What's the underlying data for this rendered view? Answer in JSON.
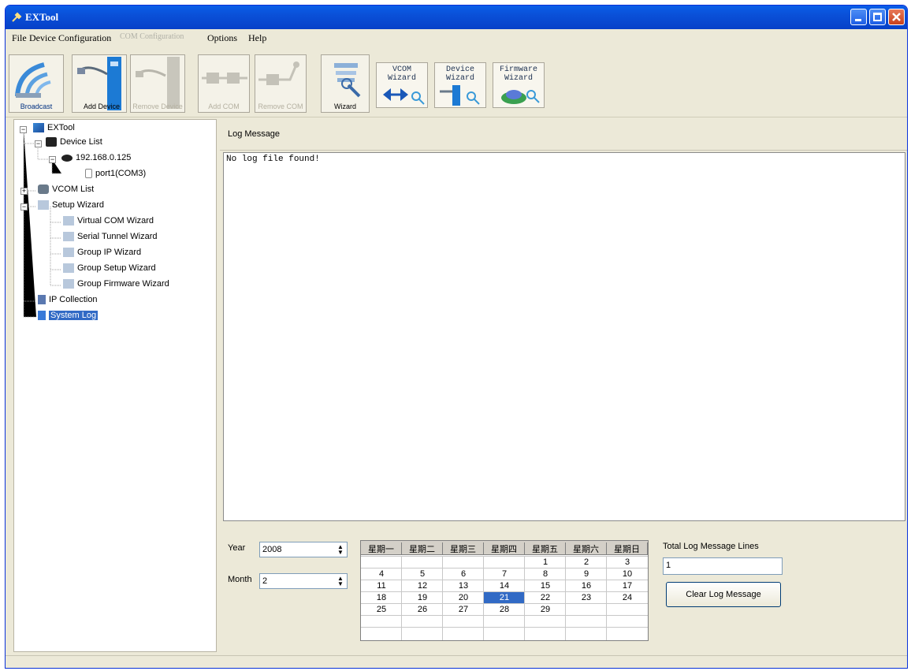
{
  "window": {
    "title": "EXTool"
  },
  "menu": {
    "file": "File",
    "device_config": "Device Configuration",
    "com_config": "COM Configuration",
    "options": "Options",
    "help": "Help"
  },
  "toolbar": {
    "broadcast": "Broadcast",
    "add_device": "Add Device",
    "remove_device": "Remove Device",
    "add_com": "Add COM",
    "remove_com": "Remove COM",
    "wizard": "Wizard",
    "vcom_wizard": "VCOM\nWizard",
    "device_wizard": "Device\nWizard",
    "firmware_wizard": "Firmware\nWizard"
  },
  "tree": {
    "root": "EXTool",
    "device_list": "Device List",
    "ip": "192.168.0.125",
    "port": "port1(COM3)",
    "vcom_list": "VCOM List",
    "setup_wizard": "Setup Wizard",
    "wizards": [
      "Virtual COM Wizard",
      "Serial Tunnel Wizard",
      "Group IP Wizard",
      "Group Setup Wizard",
      "Group Firmware Wizard"
    ],
    "ip_collection": "IP Collection",
    "system_log": "System Log"
  },
  "log": {
    "header": "Log Message",
    "content": "No log file found!"
  },
  "controls": {
    "year_label": "Year",
    "year_value": "2008",
    "month_label": "Month",
    "month_value": "2",
    "total_label": "Total Log Message Lines",
    "total_value": "1",
    "clear_button": "Clear Log Message"
  },
  "calendar": {
    "weekdays": [
      "星期一",
      "星期二",
      "星期三",
      "星期四",
      "星期五",
      "星期六",
      "星期日"
    ],
    "weeks": [
      [
        "",
        "",
        "",
        "",
        "1",
        "2",
        "3"
      ],
      [
        "4",
        "5",
        "6",
        "7",
        "8",
        "9",
        "10"
      ],
      [
        "11",
        "12",
        "13",
        "14",
        "15",
        "16",
        "17"
      ],
      [
        "18",
        "19",
        "20",
        "21",
        "22",
        "23",
        "24"
      ],
      [
        "25",
        "26",
        "27",
        "28",
        "29",
        "",
        ""
      ]
    ],
    "selected": "21"
  },
  "colors": {
    "titlebar": "#0a50d8",
    "selection": "#316ac5",
    "face": "#ece9d8"
  }
}
